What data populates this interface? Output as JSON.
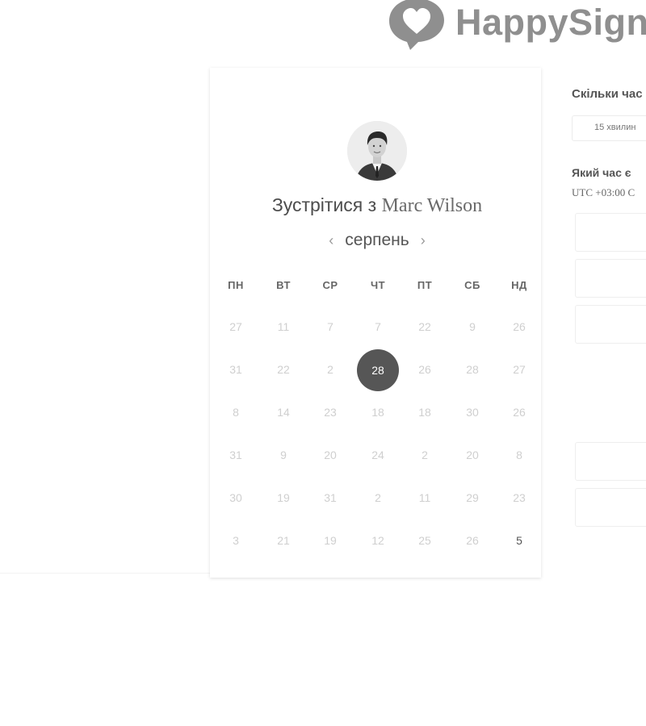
{
  "brand": {
    "name": "HappySign",
    "logo_icon": "heart-chat-bubble-icon",
    "color": "#8f8f8f"
  },
  "booking": {
    "title_prefix": "Зустрітися з",
    "host_name": "Marc Wilson",
    "avatar_icon": "person-avatar"
  },
  "calendar": {
    "month": "серпень",
    "prev_icon": "chevron-left-icon",
    "next_icon": "chevron-right-icon",
    "weekdays": [
      "ПН",
      "ВТ",
      "СР",
      "ЧТ",
      "ПТ",
      "СБ",
      "НД"
    ],
    "weeks": [
      [
        {
          "d": "27"
        },
        {
          "d": "11"
        },
        {
          "d": "7"
        },
        {
          "d": "7"
        },
        {
          "d": "22"
        },
        {
          "d": "9"
        },
        {
          "d": "26"
        }
      ],
      [
        {
          "d": "31"
        },
        {
          "d": "22"
        },
        {
          "d": "2"
        },
        {
          "d": "28",
          "selected": true
        },
        {
          "d": "26"
        },
        {
          "d": "28"
        },
        {
          "d": "27"
        }
      ],
      [
        {
          "d": "8"
        },
        {
          "d": "14"
        },
        {
          "d": "23"
        },
        {
          "d": "18"
        },
        {
          "d": "18"
        },
        {
          "d": "30"
        },
        {
          "d": "26"
        }
      ],
      [
        {
          "d": "31"
        },
        {
          "d": "9"
        },
        {
          "d": "20"
        },
        {
          "d": "24"
        },
        {
          "d": "2"
        },
        {
          "d": "20"
        },
        {
          "d": "8"
        }
      ],
      [
        {
          "d": "30"
        },
        {
          "d": "19"
        },
        {
          "d": "31"
        },
        {
          "d": "2"
        },
        {
          "d": "11"
        },
        {
          "d": "29"
        },
        {
          "d": "23"
        }
      ],
      [
        {
          "d": "3"
        },
        {
          "d": "21"
        },
        {
          "d": "19"
        },
        {
          "d": "12"
        },
        {
          "d": "25"
        },
        {
          "d": "26"
        },
        {
          "d": "5",
          "active": true
        }
      ]
    ],
    "selected_color": "#565656"
  },
  "panel": {
    "duration_question": "Скільки час",
    "duration_option": "15 хвилин",
    "time_question": "Який час є",
    "timezone": "UTC +03:00 С"
  }
}
